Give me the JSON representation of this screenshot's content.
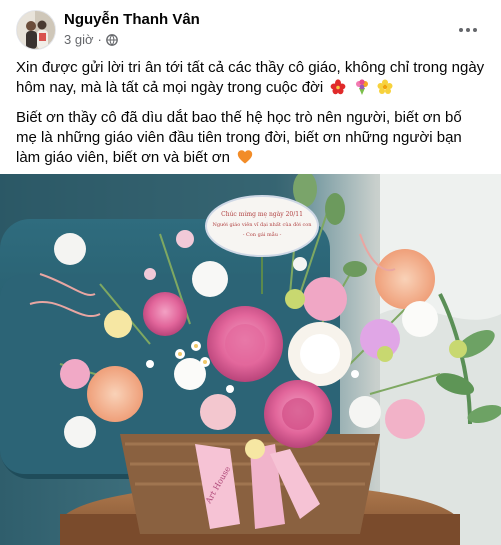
{
  "post": {
    "author": "Nguyễn Thanh Vân",
    "time": "3 giờ",
    "separator": "·",
    "paragraph1": "Xin được gửi lời tri ân tới tất cả các thầy cô giáo, không chỉ trong ngày hôm nay, mà là tất cả mọi ngày trong cuộc đời",
    "paragraph1_emojis": [
      "hibiscus-emoji",
      "bouquet-emoji",
      "blossom-emoji"
    ],
    "paragraph2": "Biết ơn thầy cô đã dìu dắt bao thế hệ học trò nên người, biết ơn bố mẹ là những giáo viên đầu tiên trong đời, biết ơn những người bạn làm giáo viên, biết ơn và biết ơn",
    "paragraph2_emojis": [
      "orange-heart-emoji"
    ],
    "card_text": [
      "Chúc mừng mẹ ngày 20/11",
      "Người giáo viên vĩ đại nhất của đời con",
      "- Con gái mẫu -"
    ],
    "ribbon_text": "Art House",
    "photo_subject": "flower-basket",
    "colors": {
      "name": "#050505",
      "meta": "#65676b",
      "background": "#ffffff"
    }
  }
}
